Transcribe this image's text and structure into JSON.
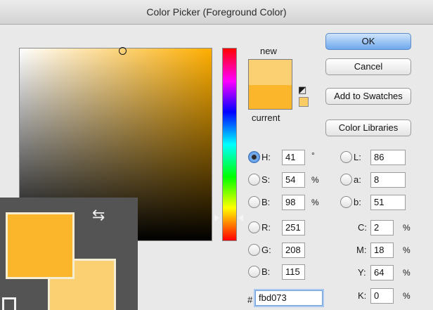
{
  "window": {
    "title": "Color Picker (Foreground Color)"
  },
  "preview": {
    "new_label": "new",
    "current_label": "current",
    "new_color": "#fbd073",
    "current_color": "#fbb62b",
    "websafe_color": "#f9cc66"
  },
  "buttons": {
    "ok": "OK",
    "cancel": "Cancel",
    "add_swatches": "Add to Swatches",
    "color_libraries": "Color Libraries"
  },
  "hsb": {
    "h_label": "H:",
    "h_value": "41",
    "h_unit": "°",
    "s_label": "S:",
    "s_value": "54",
    "s_unit": "%",
    "b_label": "B:",
    "b_value": "98",
    "b_unit": "%"
  },
  "rgb": {
    "r_label": "R:",
    "r_value": "251",
    "g_label": "G:",
    "g_value": "208",
    "b_label": "B:",
    "b_value": "115"
  },
  "lab": {
    "l_label": "L:",
    "l_value": "86",
    "a_label": "a:",
    "a_value": "8",
    "b_label": "b:",
    "b_value": "51"
  },
  "cmyk": {
    "c_label": "C:",
    "c_value": "2",
    "m_label": "M:",
    "m_value": "18",
    "y_label": "Y:",
    "y_value": "64",
    "k_label": "K:",
    "k_value": "0",
    "unit": "%"
  },
  "hex": {
    "label": "#",
    "value": "fbd073"
  },
  "tool_overlay": {
    "foreground_color": "#fbb62b",
    "background_color": "#fbd073",
    "swap_icon": "swap-arrows-icon"
  }
}
